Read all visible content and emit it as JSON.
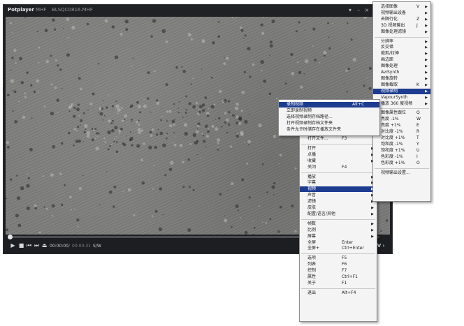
{
  "window": {
    "app_name": "Potplayer",
    "app_arrow": "▾",
    "tag": "MHF",
    "filename": "BLSQC0816.MHF",
    "buttons": [
      "▾",
      "–",
      "×"
    ]
  },
  "playback": {
    "position_fraction": 0.0,
    "current_time": "00:00:00",
    "separator": "/",
    "total_time": "00:00:31",
    "format": "S/W",
    "tv_label": "TV ›",
    "icons": {
      "play": "▶",
      "stop": "■",
      "prev": "⏮",
      "next": "⏭",
      "eject": "⏏"
    }
  },
  "menu_main": {
    "items": [
      {
        "label": "打开文件...",
        "key": "F3"
      },
      {
        "sep": true
      },
      {
        "label": "打开",
        "sub": true
      },
      {
        "label": "点播",
        "sub": true
      },
      {
        "label": "收藏",
        "sub": true
      },
      {
        "label": "关闭",
        "key": "F4"
      },
      {
        "sep": true
      },
      {
        "label": "播放",
        "sub": true
      },
      {
        "label": "字幕",
        "sub": true
      },
      {
        "label": "视频",
        "sub": true,
        "hl": true
      },
      {
        "label": "声音",
        "sub": true
      },
      {
        "label": "滤镜",
        "sub": true
      },
      {
        "label": "皮肤",
        "sub": true
      },
      {
        "label": "配置/语言/其他",
        "sub": true
      },
      {
        "sep": true
      },
      {
        "label": "帧数",
        "sub": true
      },
      {
        "label": "比例",
        "sub": true
      },
      {
        "label": "屏幕",
        "sub": true
      },
      {
        "label": "全屏",
        "key": "Enter"
      },
      {
        "label": "全屏+",
        "key": "Ctrl+Enter"
      },
      {
        "sep": true
      },
      {
        "label": "选项",
        "key": "F5"
      },
      {
        "label": "列表",
        "key": "F6"
      },
      {
        "label": "控制",
        "key": "F7"
      },
      {
        "label": "属性",
        "key": "Ctrl+F1"
      },
      {
        "label": "关于",
        "key": "F1"
      },
      {
        "sep": true
      },
      {
        "label": "退出",
        "key": "Alt+F4"
      }
    ]
  },
  "menu_video": {
    "items": [
      {
        "label": "选择图像",
        "key": "V",
        "sub": true
      },
      {
        "label": "视频输出设备",
        "sub": true
      },
      {
        "label": "去隔行化",
        "key": "Z",
        "sub": true
      },
      {
        "label": "3D 视频输出",
        "key": "J",
        "sub": true
      },
      {
        "label": "图像处理滤镜",
        "sub": true
      },
      {
        "sep": true
      },
      {
        "label": "分辨率",
        "sub": true
      },
      {
        "label": "反交错",
        "sub": true
      },
      {
        "label": "裁剪/拉伸",
        "sub": true
      },
      {
        "label": "画边距",
        "sub": true
      },
      {
        "label": "图像处理",
        "sub": true
      },
      {
        "label": "AviSynth",
        "sub": true
      },
      {
        "label": "图像旋转",
        "sub": true
      },
      {
        "label": "图像截取",
        "key": "K",
        "sub": true
      },
      {
        "label": "视频录制",
        "sub": true,
        "hl": true
      },
      {
        "label": "VapourSynth",
        "sub": true
      },
      {
        "label": "播放 360 度视频",
        "sub": true
      },
      {
        "sep": true
      },
      {
        "label": "图像属性跟位",
        "key": "Q",
        "check": true
      },
      {
        "label": "亮度 -1%",
        "key": "W"
      },
      {
        "label": "亮度 +1%",
        "key": "E"
      },
      {
        "label": "对比度 -1%",
        "key": "R"
      },
      {
        "label": "对比度 +1%",
        "key": "T"
      },
      {
        "label": "饱和度 -1%",
        "key": "Y"
      },
      {
        "label": "饱和度 +1%",
        "key": "U"
      },
      {
        "label": "色彩度 -1%",
        "key": "I"
      },
      {
        "label": "色彩度 +1%",
        "key": "O"
      },
      {
        "sep": true
      },
      {
        "label": "视频输出设置..."
      }
    ]
  },
  "menu_record": {
    "items": [
      {
        "label": "录制视频",
        "key": "Alt+C",
        "hl": true
      },
      {
        "label": "立即录制视频"
      },
      {
        "label": "选择视频录制存档路径..."
      },
      {
        "label": "打开视频录制存档文件夹"
      },
      {
        "label": "条件允许时储存在播放文件夹"
      }
    ]
  },
  "colors": {
    "menu_highlight": "#1d3c8f",
    "menu_bg": "#f4f4f4",
    "player_bg": "#1d1e21",
    "video_gray": "#7b7c7a"
  }
}
